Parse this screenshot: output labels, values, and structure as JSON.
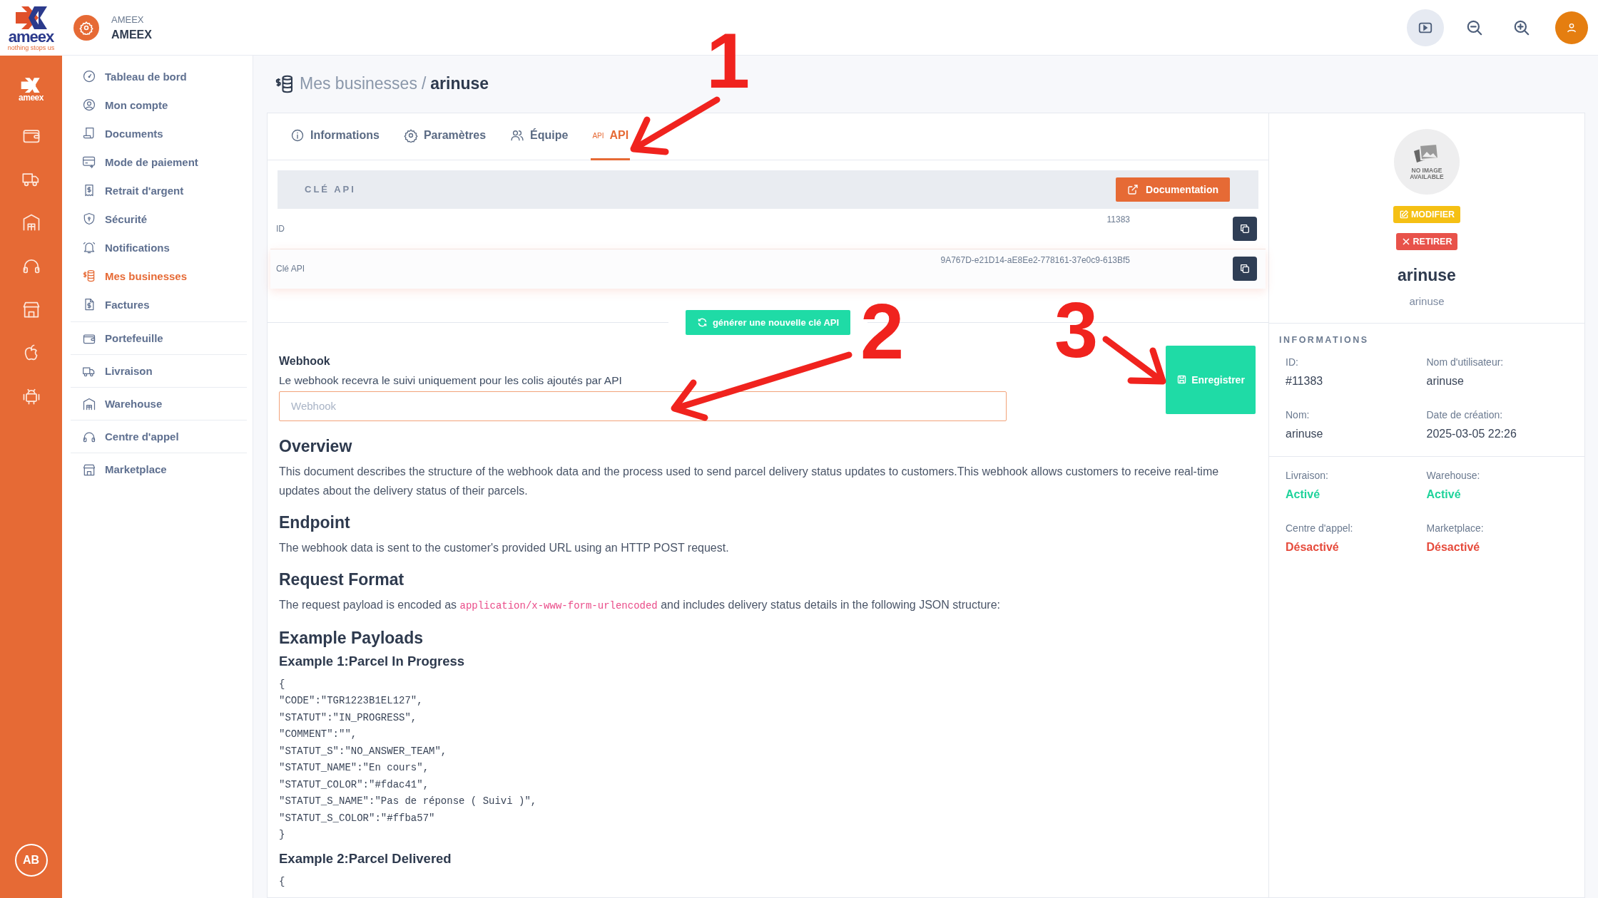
{
  "brand": {
    "logo_text": "ameex",
    "tagline": "nothing stops us",
    "rail_logo_text": "ameex"
  },
  "rail": {
    "items": [
      {
        "kind": "wallet"
      },
      {
        "kind": "truck"
      },
      {
        "kind": "warehouse"
      },
      {
        "kind": "headset"
      },
      {
        "kind": "store"
      },
      {
        "kind": "apple"
      },
      {
        "kind": "android"
      }
    ],
    "avatar": "AB"
  },
  "account": {
    "label": "AMEEX",
    "name": "AMEEX"
  },
  "sidebar": {
    "main": [
      {
        "label": "Tableau de bord",
        "kind": "gauge",
        "selected": false
      },
      {
        "label": "Mon compte",
        "kind": "user",
        "selected": false
      },
      {
        "label": "Documents",
        "kind": "document",
        "selected": false
      },
      {
        "label": "Mode de paiement",
        "kind": "card",
        "selected": false
      },
      {
        "label": "Retrait d'argent",
        "kind": "receipt",
        "selected": false
      },
      {
        "label": "Sécurité",
        "kind": "shield",
        "selected": false
      },
      {
        "label": "Notifications",
        "kind": "bell",
        "selected": false
      },
      {
        "label": "Mes businesses",
        "kind": "coins",
        "selected": true
      },
      {
        "label": "Factures",
        "kind": "invoice",
        "selected": false
      }
    ],
    "modules": [
      {
        "label": "Portefeuille",
        "kind": "wallet",
        "selected": false
      },
      {
        "label": "Livraison",
        "kind": "truck",
        "selected": false
      },
      {
        "label": "Warehouse",
        "kind": "warehouse",
        "selected": false
      },
      {
        "label": "Centre d'appel",
        "kind": "headset",
        "selected": false
      },
      {
        "label": "Marketplace",
        "kind": "store",
        "selected": false
      }
    ]
  },
  "breadcrumb": {
    "parent": "Mes businesses",
    "separator": "/",
    "current": "arinuse"
  },
  "tabs": [
    {
      "label": "Informations",
      "kind": "info",
      "selected": false
    },
    {
      "label": "Paramètres",
      "kind": "gear",
      "selected": false
    },
    {
      "label": "Équipe",
      "kind": "users",
      "selected": false
    },
    {
      "label": "API",
      "kind": "api",
      "icon_text": "API",
      "selected": true
    }
  ],
  "api_key": {
    "title": "CLÉ API",
    "doc_button": "Documentation",
    "rows": [
      {
        "label": "ID",
        "value": "11383"
      },
      {
        "label": "Clé API",
        "value": "9A767D-e21D14-aE8Ee2-778161-37e0c9-613Bf5"
      }
    ],
    "regenerate_button": "générer une nouvelle clé API"
  },
  "webhook": {
    "label": "Webhook",
    "hint": "Le webhook recevra le suivi uniquement pour les colis ajoutés par API",
    "placeholder": "Webhook",
    "save_button": "Enregistrer"
  },
  "docs": [
    {
      "kind": "heading",
      "text": "Overview"
    },
    {
      "kind": "paragraph",
      "text": "This document describes the structure of the webhook data and the process used to send parcel delivery status updates to customers.This webhook allows customers to receive real-time updates about the delivery status of their parcels."
    },
    {
      "kind": "heading",
      "text": "Endpoint"
    },
    {
      "kind": "paragraph",
      "text": "The webhook data is sent to the customer's provided URL using an HTTP POST request."
    },
    {
      "kind": "heading",
      "text": "Request Format"
    },
    {
      "kind": "paragraph_code",
      "before": "The request payload is encoded as",
      "code": "application/x-www-form-urlencoded",
      "after": "and includes delivery status details in the following JSON structure:"
    },
    {
      "kind": "heading",
      "text": "Example Payloads"
    },
    {
      "kind": "subheading",
      "text": "Example 1:Parcel In Progress"
    },
    {
      "kind": "code",
      "lines": [
        "{",
        "\"CODE\":\"TGR1223B1EL127\",",
        "\"STATUT\":\"IN_PROGRESS\",",
        "\"COMMENT\":\"\",",
        "\"STATUT_S\":\"NO_ANSWER_TEAM\",",
        "\"STATUT_NAME\":\"En cours\",",
        "\"STATUT_COLOR\":\"#fdac41\",",
        "\"STATUT_S_NAME\":\"Pas de réponse ( Suivi )\",",
        "\"STATUT_S_COLOR\":\"#ffba57\"",
        "}"
      ]
    },
    {
      "kind": "subheading",
      "text": "Example 2:Parcel Delivered"
    },
    {
      "kind": "code",
      "lines": [
        "{"
      ]
    }
  ],
  "profile": {
    "image_text": [
      "NO IMAGE",
      "AVAILABLE"
    ],
    "edit_button": "MODIFIER",
    "remove_button": "RETIRER",
    "name": "arinuse",
    "username": "arinuse",
    "section_title": "INFORMATIONS",
    "fields": [
      {
        "label": "ID:",
        "value": "#11383"
      },
      {
        "label": "Nom d'utilisateur:",
        "value": "arinuse"
      },
      {
        "label": "Nom:",
        "value": "arinuse"
      },
      {
        "label": "Date de création:",
        "value": "2025-03-05 22:26"
      }
    ],
    "modules": [
      {
        "label": "Livraison:",
        "value": "Activé",
        "on": true
      },
      {
        "label": "Warehouse:",
        "value": "Activé",
        "on": true
      },
      {
        "label": "Centre d'appel:",
        "value": "Désactivé",
        "on": false
      },
      {
        "label": "Marketplace:",
        "value": "Désactivé",
        "on": false
      }
    ]
  },
  "annotations": [
    {
      "text": "1"
    },
    {
      "text": "2"
    },
    {
      "text": "3"
    }
  ]
}
